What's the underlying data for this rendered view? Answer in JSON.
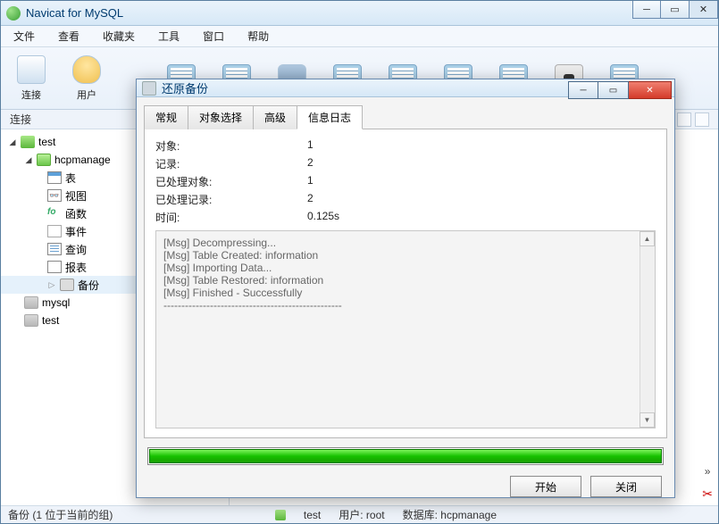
{
  "app": {
    "title": "Navicat for MySQL"
  },
  "menu": {
    "file": "文件",
    "view": "查看",
    "fav": "收藏夹",
    "tool": "工具",
    "window": "窗口",
    "help": "帮助"
  },
  "toolbar": {
    "connect": "连接",
    "user": "用户"
  },
  "sub_toolbar": {
    "left": "连接"
  },
  "tree": {
    "root": "test",
    "db": "hcpmanage",
    "table": "表",
    "view": "视图",
    "func": "函数",
    "event": "事件",
    "query": "查询",
    "report": "报表",
    "backup": "备份",
    "mysql": "mysql",
    "test2": "test"
  },
  "dialog": {
    "title": "还原备份",
    "tabs": {
      "general": "常规",
      "objsel": "对象选择",
      "advanced": "高级",
      "log": "信息日志"
    },
    "info": {
      "objects_label": "对象:",
      "objects_val": "1",
      "records_label": "记录:",
      "records_val": "2",
      "proc_obj_label": "已处理对象:",
      "proc_obj_val": "1",
      "proc_rec_label": "已处理记录:",
      "proc_rec_val": "2",
      "time_label": "时间:",
      "time_val": "0.125s"
    },
    "log": {
      "l1": "[Msg] Decompressing...",
      "l2": "[Msg] Table Created: information",
      "l3": "[Msg] Importing Data...",
      "l4": "[Msg] Table Restored: information",
      "l5": "[Msg] Finished - Successfully",
      "l6": "--------------------------------------------------"
    },
    "buttons": {
      "start": "开始",
      "close": "关闭"
    }
  },
  "status": {
    "left": "备份 (1 位于当前的组)",
    "conn": "test",
    "user_label": "用户: root",
    "db_label": "数据库: hcpmanage"
  }
}
